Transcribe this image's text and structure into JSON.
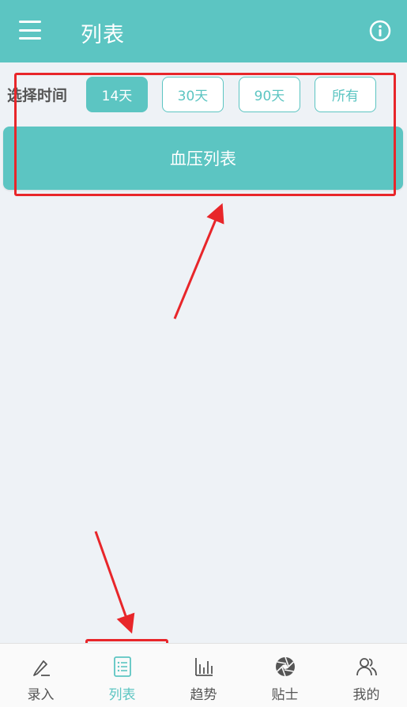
{
  "header": {
    "title": "列表",
    "menu_icon": "hamburger-menu-icon",
    "info_icon": "info-circle-icon"
  },
  "filter": {
    "label": "选择时间",
    "options": [
      "14天",
      "30天",
      "90天",
      "所有"
    ],
    "selected_index": 0
  },
  "main": {
    "bp_list_button_label": "血压列表"
  },
  "bottom_nav": {
    "items": [
      {
        "label": "录入",
        "icon": "pen-icon"
      },
      {
        "label": "列表",
        "icon": "list-icon"
      },
      {
        "label": "趋势",
        "icon": "bar-chart-icon"
      },
      {
        "label": "贴士",
        "icon": "aperture-icon"
      },
      {
        "label": "我的",
        "icon": "users-icon"
      }
    ],
    "active_index": 1
  },
  "colors": {
    "brand": "#5cc5c2",
    "background": "#eef2f6",
    "annotation": "#e8262a"
  }
}
